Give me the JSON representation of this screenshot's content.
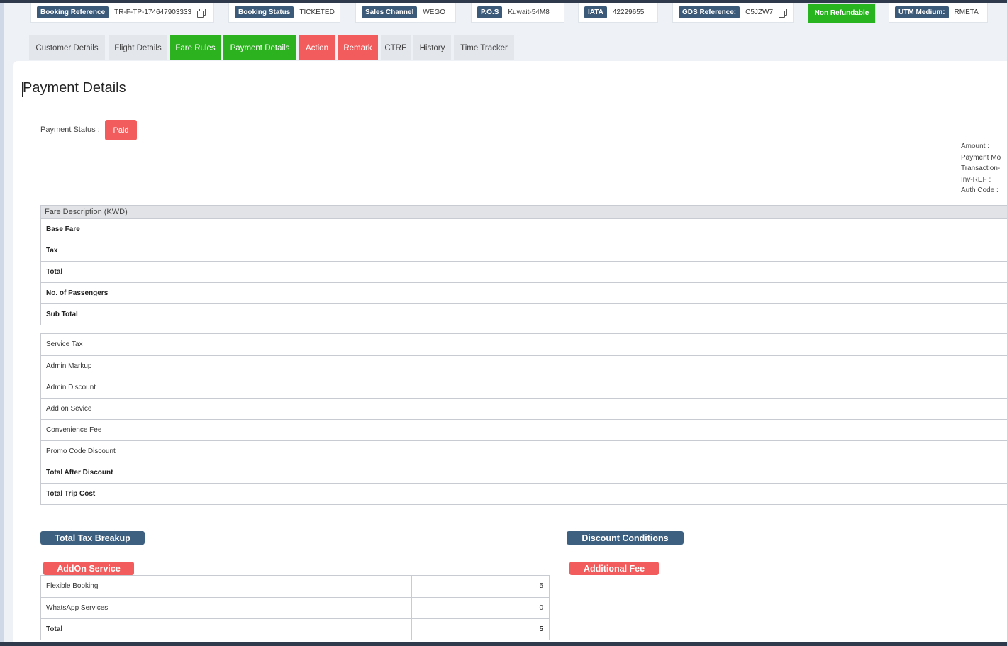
{
  "info_strip": {
    "booking_reference": {
      "label": "Booking Reference",
      "value": "TR-F-TP-174647903333"
    },
    "booking_status": {
      "label": "Booking Status",
      "value": "TICKETED"
    },
    "sales_channel": {
      "label": "Sales Channel",
      "value": "WEGO"
    },
    "pos": {
      "label": "P.O.S",
      "value": "Kuwait-54M8"
    },
    "iata": {
      "label": "IATA",
      "value": "42229655"
    },
    "gds_reference": {
      "label": "GDS Reference:",
      "value": "C5JZW7"
    },
    "refund_badge": "Non Refundable",
    "utm_medium": {
      "label": "UTM Medium:",
      "value": "RMETA"
    }
  },
  "tabs": [
    {
      "label": "Customer Details"
    },
    {
      "label": "Flight Details"
    },
    {
      "label": "Fare Rules"
    },
    {
      "label": "Payment Details"
    },
    {
      "label": "Action"
    },
    {
      "label": "Remark"
    },
    {
      "label": "CTRE"
    },
    {
      "label": "History"
    },
    {
      "label": "Time Tracker"
    }
  ],
  "page_title": "Payment Details",
  "payment_status": {
    "label": "Payment Status :",
    "value": "Paid"
  },
  "payment_meta": [
    "Amount :",
    "Payment Mo",
    "Transaction-",
    "Inv-REF :",
    "Auth Code :"
  ],
  "fare_table": {
    "header": "Fare Description (KWD)",
    "rows": [
      "Base Fare",
      "Tax",
      "Total",
      "No. of Passengers",
      "Sub Total"
    ]
  },
  "fee_table": {
    "rows": [
      "Service Tax",
      "Admin Markup",
      "Admin Discount",
      "Add on Sevice",
      "Convenience Fee",
      "Promo Code Discount",
      "Total After Discount",
      "Total Trip Cost"
    ]
  },
  "sections": {
    "total_tax_breakup": "Total Tax Breakup",
    "discount_conditions": "Discount Conditions",
    "addon_service": "AddOn Service",
    "additional_fee": "Additional Fee"
  },
  "addon_table": [
    {
      "name": "Flexible Booking",
      "value": "5"
    },
    {
      "name": "WhatsApp Services",
      "value": "0"
    },
    {
      "name": "Total",
      "value": "5"
    }
  ],
  "colors": {
    "label_blue": "#3b5a7a",
    "green": "#2db21f",
    "red": "#f25c5c"
  }
}
